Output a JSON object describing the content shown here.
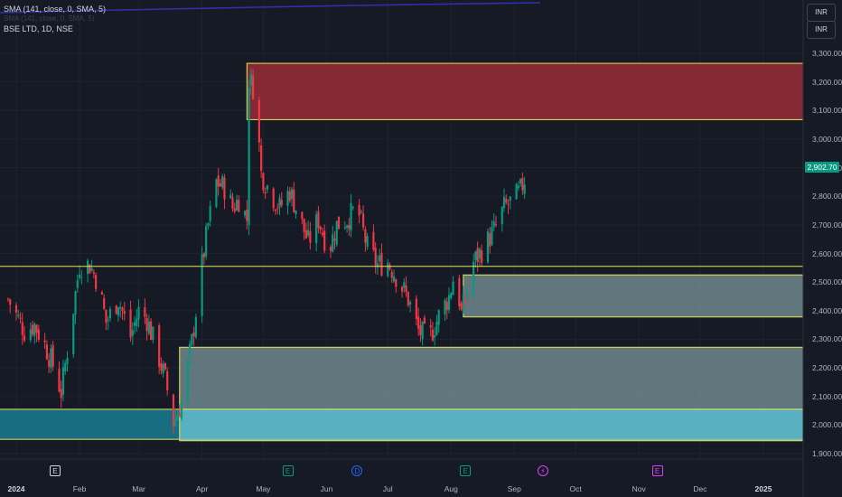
{
  "header": {
    "indicator": "SMA (141, close, 0, SMA, 5)",
    "indicator2": "SMA (141, close, 0, SMA, 5)",
    "symbol": "BSE LTD, 1D, NSE"
  },
  "currency_buttons": [
    "INR",
    "INR"
  ],
  "last_price": "2,902.70",
  "colors": {
    "background": "#161a25",
    "bull": "#089981",
    "bear": "#f23645",
    "supply_zone": "#8b2a35",
    "demand_zone": "#7e9aa0",
    "zone_border": "#e6e65a",
    "sma_line": "#3030b0"
  },
  "events": [
    {
      "month": "Jan",
      "day": 20,
      "glyph": "E",
      "color": "#d1d4dc",
      "shape": "square"
    },
    {
      "month": "May",
      "day": 13,
      "glyph": "E",
      "color": "#089981",
      "shape": "square"
    },
    {
      "month": "Jun",
      "day": 16,
      "glyph": "D",
      "color": "#2962ff",
      "shape": "circle"
    },
    {
      "month": "Aug",
      "day": 8,
      "glyph": "E",
      "color": "#089981",
      "shape": "square"
    },
    {
      "month": "Sep",
      "day": 15,
      "glyph": "⚡",
      "color": "#e040fb",
      "shape": "circle"
    },
    {
      "month": "Nov",
      "day": 10,
      "glyph": "E",
      "color": "#e040fb",
      "shape": "square"
    }
  ],
  "chart_data": {
    "type": "candlestick",
    "title": "BSE LTD, 1D, NSE",
    "ylim": [
      1870,
      3350
    ],
    "y_ticks": [
      1900,
      2000,
      2100,
      2200,
      2300,
      2400,
      2500,
      2600,
      2700,
      2800,
      2900,
      3000,
      3100,
      3200,
      3300
    ],
    "y_tick_labels": [
      "1,900.00",
      "2,000.00",
      "2,100.00",
      "2,200.00",
      "2,300.00",
      "2,400.00",
      "2,500.00",
      "2,600.00",
      "2,700.00",
      "2,800.00",
      "2,900.00",
      "3,000.00",
      "3,100.00",
      "3,200.00",
      "3,300.00"
    ],
    "x_ticks": [
      {
        "label": "2024",
        "date": "2024-01-01",
        "bold": true
      },
      {
        "label": "Feb",
        "date": "2024-02-01"
      },
      {
        "label": "Mar",
        "date": "2024-03-01"
      },
      {
        "label": "Apr",
        "date": "2024-04-01"
      },
      {
        "label": "May",
        "date": "2024-05-01"
      },
      {
        "label": "Jun",
        "date": "2024-06-01"
      },
      {
        "label": "Jul",
        "date": "2024-07-01"
      },
      {
        "label": "Aug",
        "date": "2024-08-01"
      },
      {
        "label": "Sep",
        "date": "2024-09-01"
      },
      {
        "label": "Oct",
        "date": "2024-10-01"
      },
      {
        "label": "Nov",
        "date": "2024-11-01"
      },
      {
        "label": "Dec",
        "date": "2024-12-01"
      },
      {
        "label": "2025",
        "date": "2025-01-01",
        "bold": true
      }
    ],
    "zones": [
      {
        "kind": "supply",
        "from": "2024-04-23",
        "to": null,
        "top": 3265,
        "bottom": 3068
      },
      {
        "kind": "demand",
        "from": "2024-08-07",
        "to": null,
        "top": 2525,
        "bottom": 2378
      },
      {
        "kind": "demand",
        "from": "2024-03-21",
        "to": null,
        "top": 2272,
        "bottom": 2055
      },
      {
        "kind": "demand",
        "from": "2023-12-01",
        "to": null,
        "top": 2055,
        "bottom": 1950
      },
      {
        "kind": "demand",
        "from": "2024-03-21",
        "to": null,
        "top": 2055,
        "bottom": 1945
      }
    ],
    "hlines": [
      {
        "value": 2555,
        "color": "#e6e65a"
      }
    ],
    "sma_line": {
      "from": "2023-12-01",
      "to": "2024-09-08",
      "values_above_range": true
    },
    "close_path": [
      [
        "2023-12-28",
        2440
      ],
      [
        "2024-01-05",
        2330
      ],
      [
        "2024-01-10",
        2350
      ],
      [
        "2024-01-15",
        2280
      ],
      [
        "2024-01-19",
        2210
      ],
      [
        "2024-01-23",
        2115
      ],
      [
        "2024-01-26",
        2260
      ],
      [
        "2024-02-01",
        2560
      ],
      [
        "2024-02-06",
        2560
      ],
      [
        "2024-02-10",
        2500
      ],
      [
        "2024-02-14",
        2360
      ],
      [
        "2024-02-20",
        2440
      ],
      [
        "2024-02-26",
        2310
      ],
      [
        "2024-03-01",
        2400
      ],
      [
        "2024-03-05",
        2370
      ],
      [
        "2024-03-09",
        2280
      ],
      [
        "2024-03-14",
        2160
      ],
      [
        "2024-03-18",
        2010
      ],
      [
        "2024-03-22",
        2080
      ],
      [
        "2024-03-27",
        2290
      ],
      [
        "2024-04-01",
        2560
      ],
      [
        "2024-04-04",
        2700
      ],
      [
        "2024-04-08",
        2850
      ],
      [
        "2024-04-12",
        2830
      ],
      [
        "2024-04-16",
        2760
      ],
      [
        "2024-04-19",
        2790
      ],
      [
        "2024-04-23",
        2720
      ],
      [
        "2024-04-24",
        3210
      ],
      [
        "2024-04-27",
        3170
      ],
      [
        "2024-04-30",
        2880
      ],
      [
        "2024-05-04",
        2820
      ],
      [
        "2024-05-09",
        2760
      ],
      [
        "2024-05-14",
        2820
      ],
      [
        "2024-05-18",
        2740
      ],
      [
        "2024-05-23",
        2640
      ],
      [
        "2024-05-28",
        2720
      ],
      [
        "2024-06-02",
        2610
      ],
      [
        "2024-06-06",
        2700
      ],
      [
        "2024-06-11",
        2720
      ],
      [
        "2024-06-16",
        2760
      ],
      [
        "2024-06-21",
        2620
      ],
      [
        "2024-06-26",
        2560
      ],
      [
        "2024-07-01",
        2570
      ],
      [
        "2024-07-06",
        2510
      ],
      [
        "2024-07-11",
        2440
      ],
      [
        "2024-07-16",
        2330
      ],
      [
        "2024-07-21",
        2300
      ],
      [
        "2024-07-26",
        2380
      ],
      [
        "2024-07-31",
        2450
      ],
      [
        "2024-08-03",
        2540
      ],
      [
        "2024-08-06",
        2390
      ],
      [
        "2024-08-08",
        2440
      ],
      [
        "2024-08-12",
        2570
      ],
      [
        "2024-08-17",
        2620
      ],
      [
        "2024-08-22",
        2680
      ],
      [
        "2024-08-27",
        2760
      ],
      [
        "2024-09-01",
        2790
      ],
      [
        "2024-09-04",
        2820
      ],
      [
        "2024-09-08",
        2903
      ]
    ]
  }
}
